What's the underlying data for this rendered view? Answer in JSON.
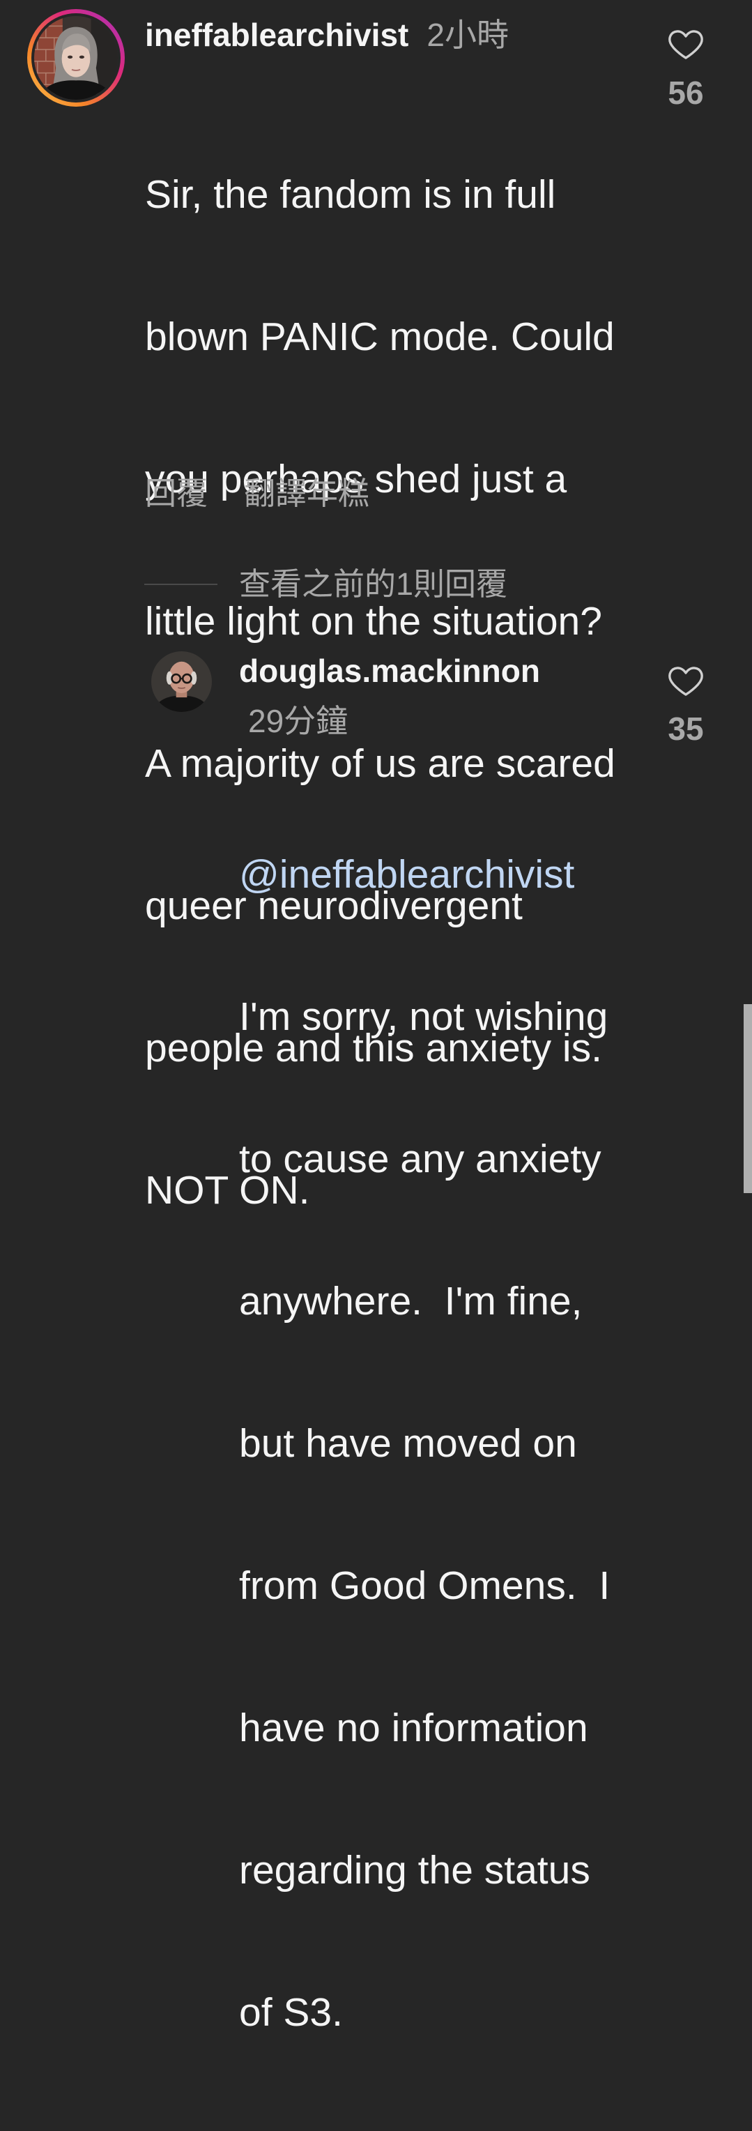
{
  "comment": {
    "username": "ineffablearchivist",
    "time": "2小時",
    "text_lines": [
      "Sir, the fandom is in full",
      "blown PANIC mode. Could",
      "you perhaps shed just a",
      "little light on the situation?",
      "A majority of us are scared",
      "queer neurodivergent",
      "people and this anxiety is.",
      "NOT ON."
    ],
    "like_icon": "heart-icon",
    "like_count": "56",
    "reply_label": "回覆",
    "translate_label": "翻譯年糕"
  },
  "view_previous_replies": "查看之前的1則回覆",
  "reply": {
    "username": "douglas.mackinnon",
    "time": "29分鐘",
    "mention": "@ineffablearchivist",
    "text_lines": [
      "I'm sorry, not wishing",
      "to cause any anxiety",
      "anywhere.  I'm fine,",
      "but have moved on",
      "from Good Omens.  I",
      "have no information",
      "regarding the status",
      "of S3."
    ],
    "like_icon": "heart-icon",
    "like_count": "35"
  },
  "colors": {
    "background": "#262626",
    "text": "#f5f5f5",
    "secondary_text": "#a8a8a8",
    "mention": "#c0d6f3",
    "heart_outline": "#d0d0d0",
    "divider": "#4a4a4a",
    "scrollbar": "#b0b0b0",
    "story_ring": [
      "#fdc34f",
      "#f58529 30%",
      "#dd2a7b 65%",
      "#a433c0"
    ]
  }
}
